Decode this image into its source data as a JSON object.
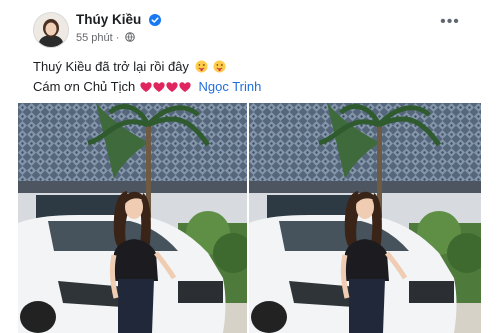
{
  "post": {
    "author": "Thúy Kiều",
    "time": "55 phút",
    "line1": "Thuý Kiều đã trở lại rồi đây",
    "line2": "Cám ơn Chủ Tịch",
    "mention": "Ngọc Trinh"
  },
  "icons": {
    "verified": "verified-badge-icon",
    "privacy": "globe-icon",
    "more": "more-options-icon",
    "emoji": "tongue-out-emoji",
    "heart": "red-heart-emoji"
  },
  "colors": {
    "link": "#216fdb",
    "verified": "#1877f2",
    "heart": "#e0245e"
  }
}
